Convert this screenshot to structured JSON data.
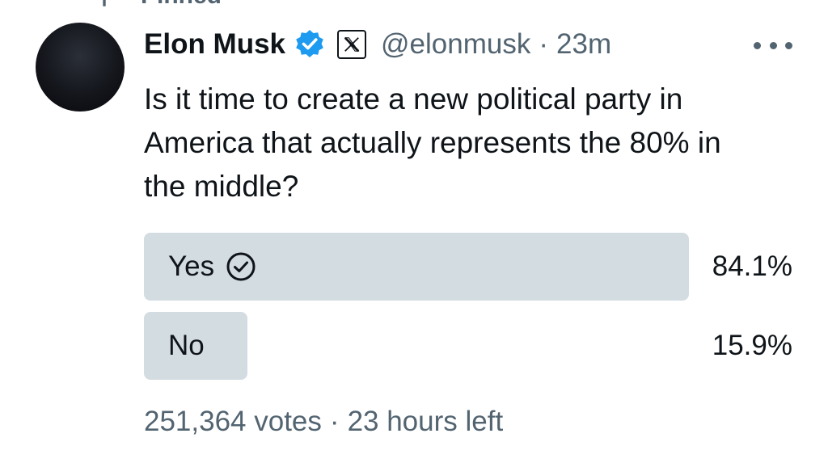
{
  "pinned": {
    "label": "Pinned"
  },
  "tweet": {
    "author_name": "Elon Musk",
    "handle": "@elonmusk",
    "separator": "·",
    "time": "23m",
    "text": "Is it time to create a new political party in\nAmerica that actually represents the 80% in\nthe middle?"
  },
  "poll": {
    "options": [
      {
        "label": "Yes",
        "percent": "84.1%",
        "share": 0.841,
        "selected": true
      },
      {
        "label": "No",
        "percent": "15.9%",
        "share": 0.159,
        "selected": false
      }
    ],
    "votes": "251,364 votes",
    "separator": "·",
    "time_left": "23 hours left"
  },
  "icons": {
    "pin": "pin-icon",
    "verified": "verified-badge-icon",
    "affiliate": "x-logo-icon",
    "more": "more-options-icon",
    "selected": "check-circle-icon"
  },
  "colors": {
    "text": "#0f1419",
    "secondary": "#536471",
    "verified": "#1d9bf0",
    "poll_bar": "#cfd9de"
  }
}
